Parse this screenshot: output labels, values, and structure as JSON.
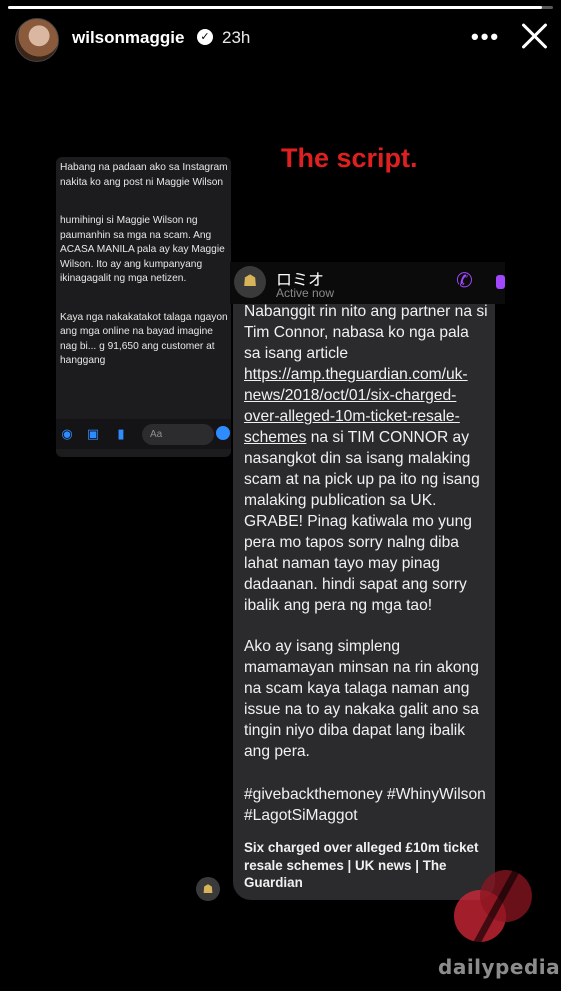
{
  "story": {
    "progress": 0.98,
    "username": "wilsonmaggie",
    "time_ago": "23h",
    "more_label": "•••"
  },
  "overlay_title": "The script.",
  "left_screenshot": {
    "paragraphs": [
      "Habang na padaan ako sa Instagram nakita ko ang post ni Maggie Wilson",
      "humihingi si Maggie Wilson ng paumanhin sa mga na scam. Ang ACASA MANILA pala ay kay Maggie Wilson. Ito ay ang kumpanyang ikinagagalit ng mga netizen.",
      "Kaya nga nakakatakot talaga ngayon ang mga online na bayad imagine nag bi... g 91,650 ang customer at hanggang"
    ],
    "input_placeholder": "Aa"
  },
  "chat": {
    "contact_name": "ロミオ",
    "status": "Active now",
    "paragraph1_before_link": "Nabanggit rin nito ang partner na si Tim Connor, nabasa ko nga pala sa isang article ",
    "link_url": "https://amp.theguardian.com/uk-news/2018/oct/01/six-charged-over-alleged-10m-ticket-resale-schemes",
    "paragraph1_after_link": " na si TIM CONNOR ay nasangkot din sa isang malaking scam at na pick up pa ito ng isang malaking publication sa UK. GRABE! Pinag katiwala mo yung pera mo tapos sorry nalng diba lahat naman tayo may pinag dadaanan. hindi sapat ang sorry ibalik ang pera ng mga tao!",
    "paragraph2": "Ako ay isang simpleng mamamayan minsan na rin akong na scam kaya talaga naman ang issue na to ay nakaka galit ano sa tingin niyo diba dapat lang ibalik ang pera.",
    "hashtags": "#givebackthemoney #WhinyWilson #LagotSiMaggot",
    "link_preview_title": "Six charged over alleged £10m ticket resale schemes | UK news | The Guardian"
  },
  "watermark": {
    "text": "dailypedia",
    "colors": {
      "red": "#d8283a",
      "dark_red": "#8c1522"
    }
  }
}
